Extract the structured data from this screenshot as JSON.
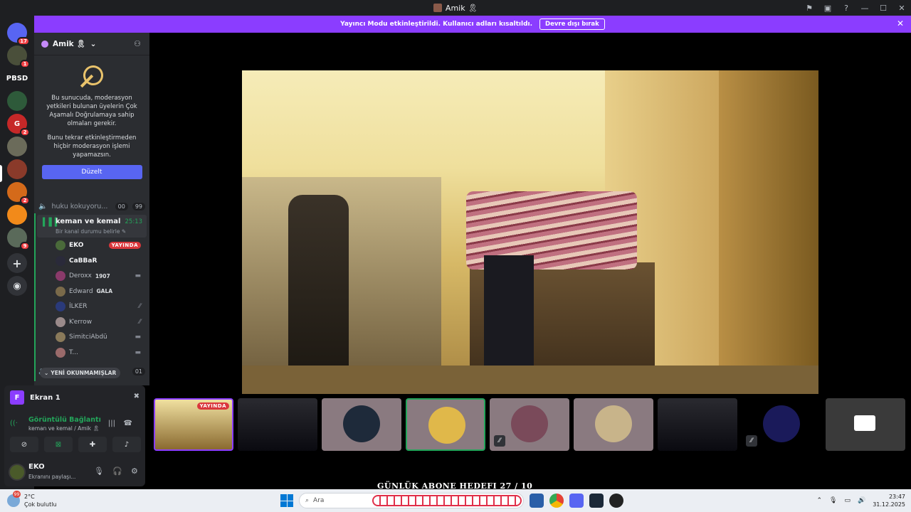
{
  "window": {
    "title": "Amik 🎗"
  },
  "banner": {
    "message": "Yayıncı Modu etkinleştirildi. Kullanıcı adları kısaltıldı.",
    "button": "Devre dışı bırak"
  },
  "guilds": [
    {
      "label": "",
      "badge": "17",
      "color": "#5865f2"
    },
    {
      "label": "",
      "badge": "1",
      "color": "#4a4f3a"
    },
    {
      "label": "PBSD",
      "badge": "",
      "color": "#1e1f22"
    },
    {
      "label": "",
      "badge": "",
      "color": "#2e5a3a"
    },
    {
      "label": "G",
      "badge": "2",
      "color": "#c62828"
    },
    {
      "label": "",
      "badge": "",
      "color": "#6b6b5a"
    },
    {
      "label": "",
      "badge": "",
      "color": "#8a3a2a"
    },
    {
      "label": "",
      "badge": "2",
      "color": "#d46a1a"
    },
    {
      "label": "",
      "badge": "",
      "color": "#f28a1a"
    },
    {
      "label": "",
      "badge": "9",
      "color": "#5a6a5a"
    }
  ],
  "server": {
    "name": "Amik 🎗",
    "mfa_notice": {
      "text1": "Bu sunucuda, moderasyon yetkileri bulunan üyelerin Çok Aşamalı Doğrulamaya sahip olmaları gerekir.",
      "text2": "Bunu tekrar etkinleştirmeden hiçbir moderasyon işlemi yapamazsın.",
      "button": "Düzelt"
    },
    "channel_above": {
      "name": "huku kokuyoru...",
      "badge_a": "00",
      "badge_b": "99"
    },
    "active_channel": {
      "name": "keman ve kemal",
      "status": "Bir kanal durumu belirle ✎",
      "timer": "25:13"
    },
    "members": [
      {
        "name": "EKO",
        "tag": "",
        "live": "YAYINDA",
        "icon": "",
        "avatar": "#4a6a3a"
      },
      {
        "name": "CaBBaR",
        "tag": "",
        "live": "",
        "icon": "",
        "avatar": "#2a2a3a"
      },
      {
        "name": "Deroxx",
        "tag": "1907",
        "live": "",
        "icon": "▬",
        "avatar": "#8a3a6a"
      },
      {
        "name": "Edward",
        "tag": "GALA",
        "live": "",
        "icon": "",
        "avatar": "#7a6a4a"
      },
      {
        "name": "İLKER",
        "tag": "",
        "live": "",
        "icon": "⁄⁄",
        "avatar": "#2a3a7a"
      },
      {
        "name": "Ƙerrow",
        "tag": "",
        "live": "",
        "icon": "⁄⁄",
        "avatar": "#9a8a8a"
      },
      {
        "name": "SimitciAbdü",
        "tag": "",
        "live": "",
        "icon": "▬",
        "avatar": "#8a7a5a"
      },
      {
        "name": "T...",
        "tag": "",
        "live": "",
        "icon": "▬",
        "avatar": "#9a6a6a"
      }
    ],
    "unread": "YENİ OKUNMAMIŞLAR",
    "unread_badge": "01"
  },
  "panel": {
    "stream_title": "Ekran 1",
    "stream_letter": "F",
    "connection_title": "Görüntülü Bağlantı Kur",
    "connection_sub": "keman ve kemal / Amik 🎗",
    "user_name": "EKO",
    "user_status": "Ekranını paylaşı..."
  },
  "stage": {
    "tiles": [
      {
        "kind": "stream",
        "live": "YAYINDA"
      },
      {
        "kind": "video"
      },
      {
        "kind": "avatar",
        "color": "#1e2a3a"
      },
      {
        "kind": "avatar",
        "color": "#e0b84a"
      },
      {
        "kind": "avatar",
        "color": "#7a4a5a"
      },
      {
        "kind": "avatar",
        "color": "#c8b48a"
      },
      {
        "kind": "video"
      },
      {
        "kind": "avatar",
        "color": "#1a1a5a"
      },
      {
        "kind": "camera"
      }
    ],
    "overlay_text": "GÜNLÜK ABONE HEDEFI   27  / 10"
  },
  "taskbar": {
    "weather_temp": "2°C",
    "weather_desc": "Çok bulutlu",
    "weather_badge": "99",
    "search_placeholder": "Ara",
    "time": "23:47",
    "date": "31.12.2025"
  }
}
